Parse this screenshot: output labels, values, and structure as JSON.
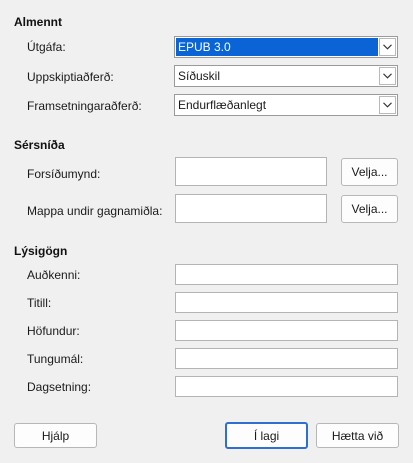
{
  "general": {
    "title": "Almennt",
    "version_label": "Útgáfa:",
    "version_value": "EPUB 3.0",
    "split_label": "Uppskiptiaðferð:",
    "split_value": "Síðuskil",
    "layout_label": "Framsetningaraðferð:",
    "layout_value": "Endurflæðanlegt"
  },
  "custom": {
    "title": "Sérsníða",
    "cover_label": "Forsíðumynd:",
    "cover_value": "",
    "cover_button": "Velja...",
    "media_label": "Mappa undir gagnamiðla:",
    "media_value": "",
    "media_button": "Velja..."
  },
  "metadata": {
    "title": "Lýsigögn",
    "id_label": "Auðkenni:",
    "title_label": "Titill:",
    "author_label": "Höfundur:",
    "language_label": "Tungumál:",
    "date_label": "Dagsetning:",
    "id_value": "",
    "title_value": "",
    "author_value": "",
    "language_value": "",
    "date_value": ""
  },
  "footer": {
    "help_label": "Hjálp",
    "ok_label": "Í lagi",
    "cancel_label": "Hætta við"
  },
  "colors": {
    "accent": "#0a64d6",
    "default_button_border": "#2f6fd0",
    "background": "#f0f0f0"
  },
  "icons": {
    "dropdown": "chevron-down-icon"
  }
}
